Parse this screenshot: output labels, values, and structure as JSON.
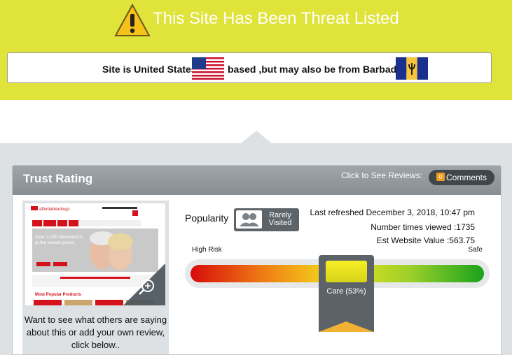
{
  "banner": {
    "title": "This Site Has Been Threat Listed"
  },
  "origin": {
    "part1": "Site is United States",
    "part2": "based ,but may also be from Barbados",
    "flag_primary": "united-states-flag",
    "flag_secondary": "barbados-flag"
  },
  "trust": {
    "title": "Trust Rating",
    "reviews_label": "Click to See Reviews:",
    "comments_badge": "0",
    "comments_label": "Comments",
    "left_text": "Want to see what others are saying about this or add your own review, click below..",
    "popularity_label": "Popularity",
    "popularity_value_line1": "Rarely",
    "popularity_value_line2": "Visited",
    "last_refreshed": "Last refreshed December 3, 2018, 10:47 pm",
    "times_viewed": "Number times viewed :1735",
    "est_value": "Est Website Value :563.75",
    "high_risk_label": "High Risk",
    "safe_label": "Safe",
    "rating_label": "Care (53%)",
    "rating_percent": 53
  },
  "thumbnail": {
    "logo": "affordablerdrugs",
    "headline": "Over 2,000 Medications at the lowest prices.",
    "section": "Most Popular Products"
  },
  "colors": {
    "banner": "#dfe33a",
    "panel_header": "#8f969c",
    "comments_badge": "#f39a1c",
    "marker": "#5b6368"
  }
}
